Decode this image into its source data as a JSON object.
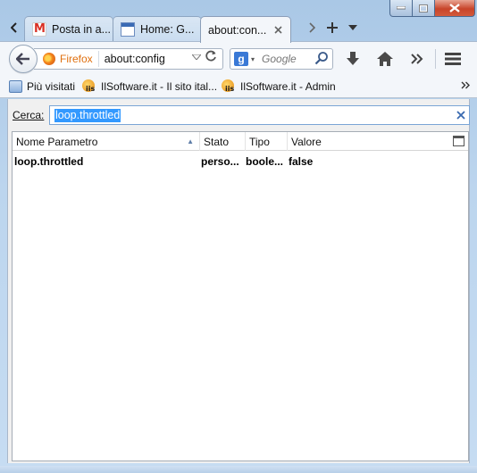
{
  "tabs": [
    {
      "label": "Posta in a...",
      "icon": "gmail-icon"
    },
    {
      "label": "Home: G...",
      "icon": "page-icon"
    },
    {
      "label": "about:con...",
      "active": true
    }
  ],
  "navbar": {
    "identity_label": "Firefox",
    "url": "about:config",
    "search_placeholder": "Google"
  },
  "bookmarks": [
    {
      "label": "Più visitati",
      "icon": "bookmark-folder-icon"
    },
    {
      "label": "IlSoftware.it - Il sito ital...",
      "icon": "ilsoftware-icon"
    },
    {
      "label": "IlSoftware.it - Admin",
      "icon": "ilsoftware-icon"
    }
  ],
  "config": {
    "search_label": "Cerca:",
    "search_value": "loop.throttled",
    "columns": [
      "Nome Parametro",
      "Stato",
      "Tipo",
      "Valore"
    ],
    "rows": [
      {
        "name": "loop.throttled",
        "status": "perso...",
        "type": "boole...",
        "value": "false"
      }
    ]
  },
  "colors": {
    "accent": "#3399ff",
    "identity": "#e0700f",
    "close_button": "#c8442a"
  }
}
